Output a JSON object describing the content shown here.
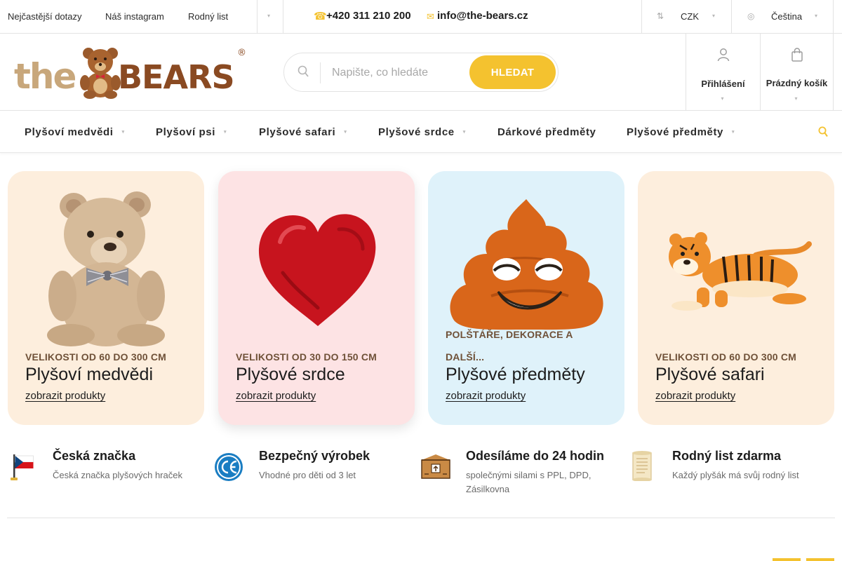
{
  "topbar": {
    "links": [
      "Nejčastější dotazy",
      "Náš instagram",
      "Rodný list"
    ],
    "phone": "+420 311 210 200",
    "email": "info@the-bears.cz",
    "currency": "CZK",
    "language": "Čeština"
  },
  "header": {
    "search": {
      "placeholder": "Napište, co hledáte",
      "button": "HLEDAT"
    },
    "login_label": "Přihlášení",
    "cart_label": "Prázdný košík"
  },
  "nav": {
    "items": [
      "Plyšoví medvědi",
      "Plyšoví psi",
      "Plyšové safari",
      "Plyšové srdce",
      "Dárkové předměty",
      "Plyšové předměty"
    ]
  },
  "categories": [
    {
      "subtitle": "VELIKOSTI OD 60 DO 300 CM",
      "title": "Plyšoví medvědi",
      "link": "zobrazit produkty",
      "bg": "#fdeedd"
    },
    {
      "subtitle": "VELIKOSTI OD 30 DO 150 CM",
      "title": "Plyšové srdce",
      "link": "zobrazit produkty",
      "bg": "#fde3e4"
    },
    {
      "subtitle": "POLŠTÁŘE, DEKORACE A DALŠÍ...",
      "title": "Plyšové předměty",
      "link": "zobrazit produkty",
      "bg": "#dff2fa"
    },
    {
      "subtitle": "VELIKOSTI OD 60 DO 300 CM",
      "title": "Plyšové safari",
      "link": "zobrazit produkty",
      "bg": "#fdeedd"
    }
  ],
  "features": [
    {
      "title": "Česká značka",
      "text": "Česká značka plyšových hraček"
    },
    {
      "title": "Bezpečný výrobek",
      "text": "Vhodné pro děti od 3 let"
    },
    {
      "title": "Odesíláme do 24 hodin",
      "text": "společnými silami s PPL, DPD, Zásilkovna"
    },
    {
      "title": "Rodný list zdarma",
      "text": "Každý plyšák má svůj rodný list"
    }
  ],
  "colors": {
    "accent": "#f4c22f",
    "subtitle": "#6f5138",
    "brand_brown": "#8a4a22"
  }
}
